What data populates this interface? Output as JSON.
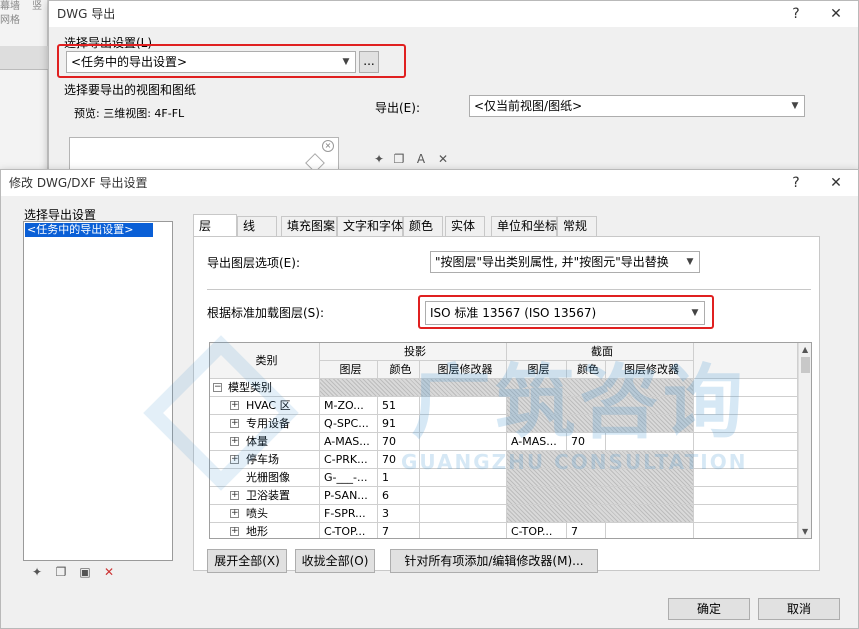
{
  "background": {
    "left_texts": [
      "幕墙",
      "竖",
      "网格"
    ]
  },
  "dwg_dialog": {
    "title": "DWG 导出",
    "help": "?",
    "close": "✕",
    "select_setting_label": "选择导出设置(L)",
    "setting_value": "<任务中的导出设置>",
    "more_button": "...",
    "views_label": "选择要导出的视图和图纸",
    "preview_text": "预览: 三维视图: 4F-FL",
    "export_label": "导出(E):",
    "export_value": "<仅当前视图/图纸>"
  },
  "modify_dialog": {
    "title": "修改 DWG/DXF 导出设置",
    "help": "?",
    "close": "✕",
    "select_setting_label": "选择导出设置",
    "settings_list": [
      "<任务中的导出设置>"
    ],
    "tabs": [
      "层",
      "线",
      "填充图案",
      "文字和字体",
      "颜色",
      "实体",
      "单位和坐标",
      "常规"
    ],
    "layer_options_label": "导出图层选项(E):",
    "layer_options_value": "\"按图层\"导出类别属性, 并\"按图元\"导出替换",
    "standard_label": "根据标准加载图层(S):",
    "standard_value": "ISO 标准 13567 (ISO 13567)",
    "table": {
      "category_header": "类别",
      "projection_header": "投影",
      "section_header": "截面",
      "sub_headers": [
        "图层",
        "颜色",
        "图层修改器",
        "图层",
        "颜色",
        "图层修改器"
      ],
      "root": "模型类别",
      "rows": [
        {
          "name": "HVAC 区",
          "expand": true,
          "p_layer": "M-ZO...",
          "p_color": "51",
          "s_layer": "",
          "s_color": "",
          "s_hatch": true
        },
        {
          "name": "专用设备",
          "expand": true,
          "p_layer": "Q-SPC...",
          "p_color": "91",
          "s_layer": "",
          "s_color": "",
          "s_hatch": true
        },
        {
          "name": "体量",
          "expand": true,
          "p_layer": "A-MAS...",
          "p_color": "70",
          "s_layer": "A-MAS...",
          "s_color": "70",
          "s_hatch": false
        },
        {
          "name": "停车场",
          "expand": true,
          "p_layer": "C-PRK...",
          "p_color": "70",
          "s_layer": "",
          "s_color": "",
          "s_hatch": true
        },
        {
          "name": "光栅图像",
          "expand": false,
          "p_layer": "G-___-...",
          "p_color": "1",
          "s_layer": "",
          "s_color": "",
          "s_hatch": true
        },
        {
          "name": "卫浴装置",
          "expand": true,
          "p_layer": "P-SAN...",
          "p_color": "6",
          "s_layer": "",
          "s_color": "",
          "s_hatch": true
        },
        {
          "name": "喷头",
          "expand": true,
          "p_layer": "F-SPR...",
          "p_color": "3",
          "s_layer": "",
          "s_color": "",
          "s_hatch": true
        },
        {
          "name": "地形",
          "expand": true,
          "p_layer": "C-TOP...",
          "p_color": "7",
          "s_layer": "C-TOP...",
          "s_color": "7",
          "s_hatch": false
        }
      ]
    },
    "expand_all": "展开全部(X)",
    "collapse_all": "收拢全部(O)",
    "add_modifier": "针对所有项添加/编辑修改器(M)...",
    "ok": "确定",
    "cancel": "取消"
  },
  "watermark": {
    "cn": "广筑咨询",
    "en": "GUANGZHU CONSULTATION"
  }
}
